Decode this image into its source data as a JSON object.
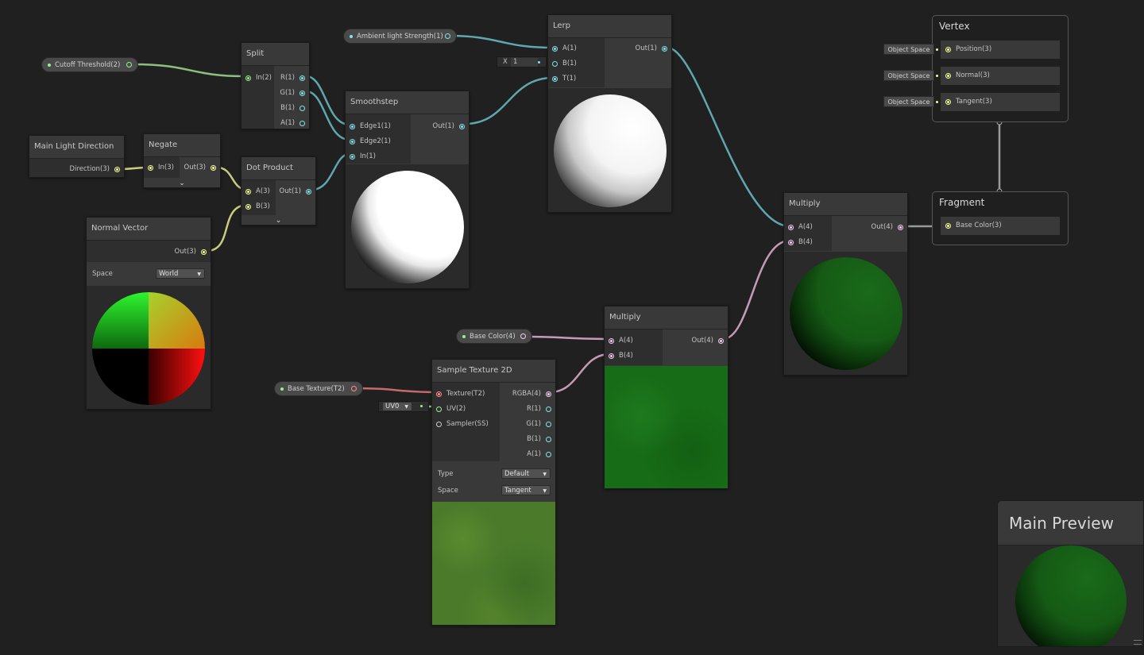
{
  "properties": {
    "cutoff": "Cutoff Threshold(2)",
    "ambient": "Ambient light Strength(1)",
    "base_color": "Base Color(4)",
    "base_texture": "Base Texture(T2)"
  },
  "nodes": {
    "split": {
      "title": "Split",
      "in": "In(2)",
      "r": "R(1)",
      "g": "G(1)",
      "b": "B(1)",
      "a": "A(1)"
    },
    "lerp": {
      "title": "Lerp",
      "a": "A(1)",
      "b": "B(1)",
      "t": "T(1)",
      "out": "Out(1)",
      "x_label": "X",
      "x_value": "1"
    },
    "smoothstep": {
      "title": "Smoothstep",
      "edge1": "Edge1(1)",
      "edge2": "Edge2(1)",
      "in": "In(1)",
      "out": "Out(1)"
    },
    "main_light": {
      "title": "Main Light Direction",
      "out": "Direction(3)"
    },
    "negate": {
      "title": "Negate",
      "in": "In(3)",
      "out": "Out(3)"
    },
    "dot_product": {
      "title": "Dot Product",
      "a": "A(3)",
      "b": "B(3)",
      "out": "Out(1)"
    },
    "normal_vector": {
      "title": "Normal Vector",
      "out": "Out(3)",
      "space_label": "Space",
      "space_value": "World"
    },
    "multiply_top": {
      "title": "Multiply",
      "a": "A(4)",
      "b": "B(4)",
      "out": "Out(4)"
    },
    "multiply_mid": {
      "title": "Multiply",
      "a": "A(4)",
      "b": "B(4)",
      "out": "Out(4)"
    },
    "sample_texture": {
      "title": "Sample Texture 2D",
      "texture": "Texture(T2)",
      "uv": "UV(2)",
      "sampler": "Sampler(SS)",
      "rgba": "RGBA(4)",
      "r": "R(1)",
      "g": "G(1)",
      "b": "B(1)",
      "a": "A(1)",
      "type_label": "Type",
      "type_value": "Default",
      "space_label": "Space",
      "space_value": "Tangent",
      "uv_dropdown": "UV0"
    }
  },
  "master": {
    "vertex": {
      "title": "Vertex",
      "slots": [
        {
          "label": "Position(3)",
          "space": "Object Space"
        },
        {
          "label": "Normal(3)",
          "space": "Object Space"
        },
        {
          "label": "Tangent(3)",
          "space": "Object Space"
        }
      ]
    },
    "fragment": {
      "title": "Fragment",
      "slots": [
        {
          "label": "Base Color(3)"
        }
      ]
    }
  },
  "main_preview": {
    "title": "Main Preview"
  },
  "colors": {
    "background": "#202020",
    "float": "#84e4e7",
    "vec2": "#9aef92",
    "vec3": "#f6ff9a",
    "vec4": "#fbcbf4",
    "texture": "#ff8b8b"
  }
}
